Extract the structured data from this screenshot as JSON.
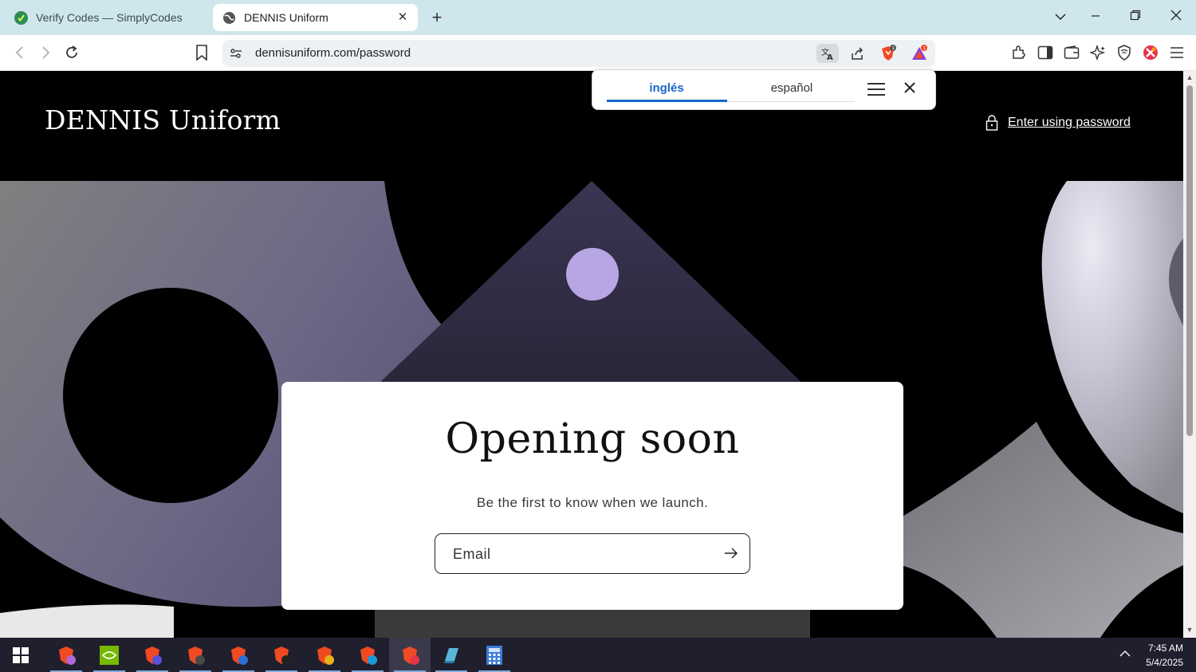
{
  "browser": {
    "tabs": [
      {
        "title": "Verify Codes — SimplyCodes",
        "active": false
      },
      {
        "title": "DENNIS Uniform",
        "active": true
      }
    ],
    "url": "dennisuniform.com/password",
    "brave_badge": "1",
    "rewards_badge": "1"
  },
  "translate": {
    "source_lang": "inglés",
    "target_lang": "español"
  },
  "site": {
    "title": "DENNIS Uniform",
    "password_link": "Enter using password"
  },
  "card": {
    "heading": "Opening soon",
    "subtitle": "Be the first to know when we launch.",
    "email_placeholder": "Email"
  },
  "taskbar": {
    "time": "7:45 AM",
    "date": "5/4/2025"
  },
  "colors": {
    "tabbar_bg": "#cfe7ec",
    "translate_accent": "#1a66c9",
    "page_bg": "#000000",
    "card_bg": "#ffffff"
  }
}
